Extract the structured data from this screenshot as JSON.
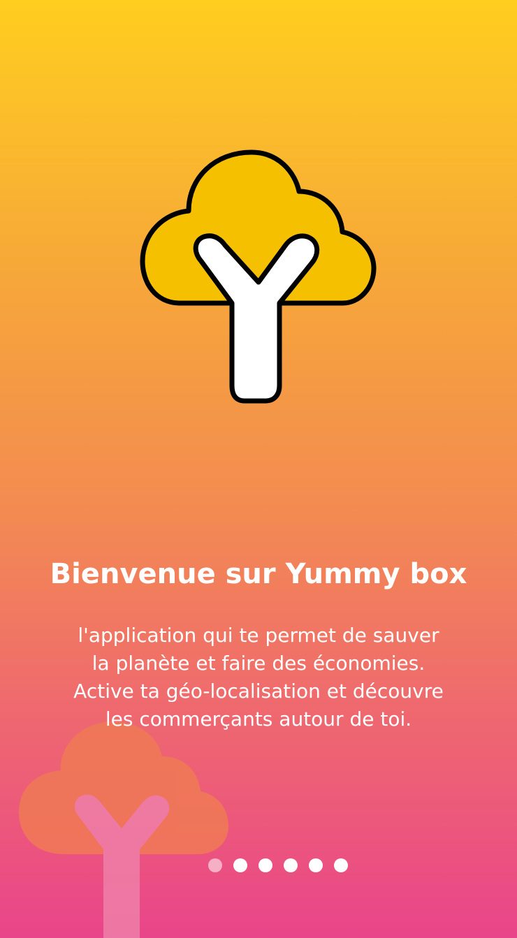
{
  "onboarding": {
    "title": "Bienvenue sur Yummy box",
    "description_lines": [
      "l'application qui te permet de sauver",
      "la planète et faire des économies.",
      "Active ta géo-localisation et découvre",
      "les commerçants autour de toi."
    ],
    "page_indicator": {
      "count": 6,
      "active_index": 0
    }
  },
  "colors": {
    "gradient_top": "#FFCE1F",
    "gradient_bottom": "#E9458A",
    "logo_cloud": "#F5C000",
    "logo_outline": "#000000",
    "logo_y": "#FFFFFF",
    "text": "#FFFFFF"
  },
  "icons": {
    "hero": "yummy-box-tree-logo",
    "background": "yummy-box-tree-watermark"
  }
}
